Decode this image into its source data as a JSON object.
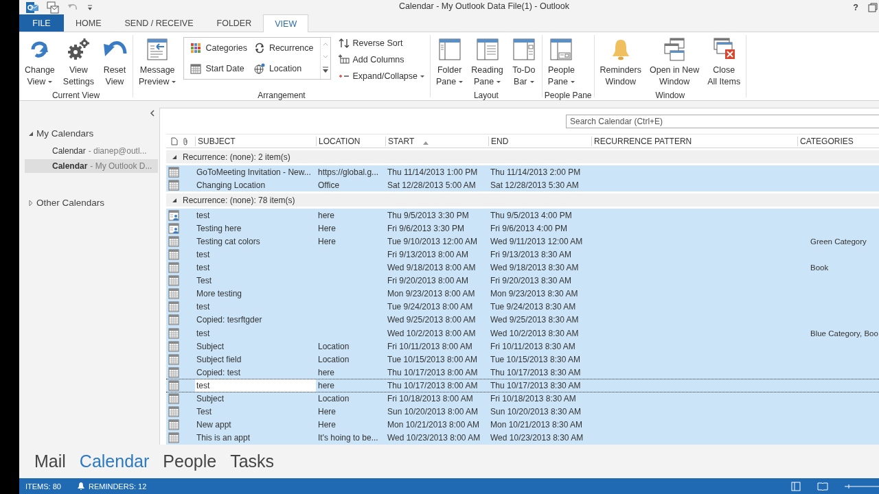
{
  "window": {
    "title": "Calendar - My Outlook Data File(1) - Outlook",
    "help": "?"
  },
  "tabs": [
    {
      "label": "FILE",
      "kind": "file",
      "selected": false
    },
    {
      "label": "HOME",
      "kind": "tab",
      "selected": false
    },
    {
      "label": "SEND / RECEIVE",
      "kind": "tab",
      "selected": false
    },
    {
      "label": "FOLDER",
      "kind": "tab",
      "selected": false
    },
    {
      "label": "VIEW",
      "kind": "tab",
      "selected": true
    }
  ],
  "ribbon": [
    {
      "label": "Current View",
      "buttons": [
        {
          "lines": [
            "Change",
            "View"
          ],
          "kind": "change",
          "dropdown": true
        },
        {
          "lines": [
            "View",
            "Settings"
          ],
          "kind": "settings",
          "dropdown": false
        },
        {
          "lines": [
            "Reset",
            "View"
          ],
          "kind": "reset",
          "dropdown": false
        }
      ]
    },
    {
      "label": "Arrangement",
      "buttons": [
        {
          "lines": [
            "Message",
            "Preview"
          ],
          "kind": "preview",
          "dropdown": true
        }
      ],
      "gallery": [
        {
          "label": "Categories",
          "kind": "categories"
        },
        {
          "label": "Recurrence",
          "kind": "recurrence"
        },
        {
          "label": "Start Date",
          "kind": "date"
        },
        {
          "label": "Location",
          "kind": "location"
        }
      ],
      "commands": [
        {
          "label": "Reverse Sort",
          "kind": "sort",
          "dropdown": false
        },
        {
          "label": "Add Columns",
          "kind": "columns",
          "dropdown": false
        },
        {
          "label": "Expand/Collapse",
          "kind": "expand",
          "dropdown": true
        }
      ]
    },
    {
      "label": "Layout",
      "buttons": [
        {
          "lines": [
            "Folder",
            "Pane"
          ],
          "kind": "folder",
          "dropdown": true
        },
        {
          "lines": [
            "Reading",
            "Pane"
          ],
          "kind": "reading",
          "dropdown": true
        },
        {
          "lines": [
            "To-Do",
            "Bar"
          ],
          "kind": "todo",
          "dropdown": true
        }
      ]
    },
    {
      "label": "People Pane",
      "buttons": [
        {
          "lines": [
            "People",
            "Pane"
          ],
          "kind": "people",
          "dropdown": true
        }
      ]
    },
    {
      "label": "Window",
      "buttons": [
        {
          "lines": [
            "Reminders",
            "Window"
          ],
          "kind": "bell",
          "dropdown": false
        },
        {
          "lines": [
            "Open in New",
            "Window"
          ],
          "kind": "newwin",
          "dropdown": false
        },
        {
          "lines": [
            "Close",
            "All Items"
          ],
          "kind": "closeall",
          "dropdown": false
        }
      ]
    }
  ],
  "navigation": {
    "sections": [
      {
        "label": "My Calendars",
        "expanded": true,
        "items": [
          {
            "name": "Calendar",
            "detail": "- dianep@outl...",
            "selected": false
          },
          {
            "name": "Calendar",
            "detail": "- My Outlook D...",
            "selected": true
          }
        ]
      },
      {
        "label": "Other Calendars",
        "expanded": false
      }
    ]
  },
  "search": {
    "placeholder": "Search Calendar (Ctrl+E)"
  },
  "table": {
    "columns": [
      {
        "label": "SUBJECT",
        "sorted": false
      },
      {
        "label": "LOCATION",
        "sorted": false
      },
      {
        "label": "START",
        "sorted": true
      },
      {
        "label": "END",
        "sorted": false
      },
      {
        "label": "RECURRENCE PATTERN",
        "sorted": false
      },
      {
        "label": "CATEGORIES",
        "sorted": false
      }
    ],
    "groups": [
      {
        "label": "Recurrence: (none): 2 item(s)",
        "expanded": true,
        "rows": [
          {
            "kind": "appointment",
            "subject": "GoToMeeting Invitation - New...",
            "location": "https://global.g...",
            "start": "Thu 11/14/2013 1:00 PM",
            "end": "Thu 11/14/2013 2:00 PM",
            "selected": true,
            "focused": false
          },
          {
            "kind": "appointment",
            "subject": "Changing Location",
            "location": "Office",
            "start": "Sat 12/28/2013 5:00 AM",
            "end": "Sat 12/28/2013 5:30 AM",
            "selected": true,
            "focused": false
          }
        ]
      },
      {
        "label": "Recurrence: (none): 78 item(s)",
        "expanded": true,
        "rows": [
          {
            "kind": "meeting",
            "subject": "test",
            "location": "here",
            "start": "Thu 9/5/2013 3:30 PM",
            "end": "Thu 9/5/2013 4:00 PM",
            "selected": true,
            "focused": false
          },
          {
            "kind": "meeting",
            "subject": "Testing here",
            "location": "Here",
            "start": "Fri 9/6/2013 3:30 PM",
            "end": "Fri 9/6/2013 4:00 PM",
            "selected": true,
            "focused": false
          },
          {
            "kind": "appointment",
            "subject": "Testing cat colors",
            "location": "Here",
            "start": "Tue 9/10/2013 12:00 AM",
            "end": "Wed 9/11/2013 12:00 AM",
            "categories": "Green Category",
            "selected": true,
            "focused": false
          },
          {
            "kind": "appointment",
            "subject": "test",
            "start": "Fri 9/13/2013 8:00 AM",
            "end": "Fri 9/13/2013 8:30 AM",
            "selected": true,
            "focused": false
          },
          {
            "kind": "appointment",
            "subject": "test",
            "start": "Wed 9/18/2013 8:00 AM",
            "end": "Wed 9/18/2013 8:30 AM",
            "categories": "Book",
            "selected": true,
            "focused": false
          },
          {
            "kind": "appointment",
            "subject": "Test",
            "start": "Fri 9/20/2013 8:00 AM",
            "end": "Fri 9/20/2013 8:30 AM",
            "selected": true,
            "focused": false
          },
          {
            "kind": "appointment",
            "subject": "More testing",
            "start": "Mon 9/23/2013 8:00 AM",
            "end": "Mon 9/23/2013 8:30 AM",
            "selected": true,
            "focused": false
          },
          {
            "kind": "appointment",
            "subject": "test",
            "start": "Tue 9/24/2013 8:00 AM",
            "end": "Tue 9/24/2013 8:30 AM",
            "selected": true,
            "focused": false
          },
          {
            "kind": "appointment",
            "subject": "Copied: tesrftgder",
            "start": "Wed 9/25/2013 8:00 AM",
            "end": "Wed 9/25/2013 8:30 AM",
            "selected": true,
            "focused": false
          },
          {
            "kind": "appointment",
            "subject": "test",
            "start": "Wed 10/2/2013 8:00 AM",
            "end": "Wed 10/2/2013 8:30 AM",
            "categories": "Blue Category, Boo",
            "selected": true,
            "focused": false
          },
          {
            "kind": "appointment",
            "subject": "Subject",
            "location": "Location",
            "start": "Fri 10/11/2013 8:00 AM",
            "end": "Fri 10/11/2013 8:30 AM",
            "selected": true,
            "focused": false
          },
          {
            "kind": "appointment",
            "subject": "Subject field",
            "location": "Location",
            "start": "Tue 10/15/2013 8:00 AM",
            "end": "Tue 10/15/2013 8:30 AM",
            "selected": true,
            "focused": false
          },
          {
            "kind": "appointment",
            "subject": "Copied: test",
            "location": "here",
            "start": "Thu 10/17/2013 8:00 AM",
            "end": "Thu 10/17/2013 8:30 AM",
            "selected": true,
            "focused": false
          },
          {
            "kind": "appointment",
            "subject": "test",
            "location": "here",
            "start": "Thu 10/17/2013 8:00 AM",
            "end": "Thu 10/17/2013 8:30 AM",
            "selected": true,
            "focused": true
          },
          {
            "kind": "appointment",
            "subject": "Subject",
            "location": "Location",
            "start": "Fri 10/18/2013 8:00 AM",
            "end": "Fri 10/18/2013 8:30 AM",
            "selected": true,
            "focused": false
          },
          {
            "kind": "appointment",
            "subject": "Test",
            "location": "Here",
            "start": "Sun 10/20/2013 8:00 AM",
            "end": "Sun 10/20/2013 8:30 AM",
            "selected": true,
            "focused": false
          },
          {
            "kind": "appointment",
            "subject": "New appt",
            "location": "Here",
            "start": "Mon 10/21/2013 8:00 AM",
            "end": "Mon 10/21/2013 8:30 AM",
            "selected": true,
            "focused": false
          },
          {
            "kind": "appointment",
            "subject": "This is an appt",
            "location": "It's hoing to be...",
            "start": "Wed 10/23/2013 8:00 AM",
            "end": "Wed 10/23/2013 8:30 AM",
            "selected": true,
            "focused": false
          }
        ]
      }
    ]
  },
  "switcher": [
    {
      "label": "Mail",
      "selected": false
    },
    {
      "label": "Calendar",
      "selected": true
    },
    {
      "label": "People",
      "selected": false
    },
    {
      "label": "Tasks",
      "selected": false
    }
  ],
  "status_bar": {
    "items": "ITEMS: 80",
    "reminders": "REMINDERS: 12"
  }
}
